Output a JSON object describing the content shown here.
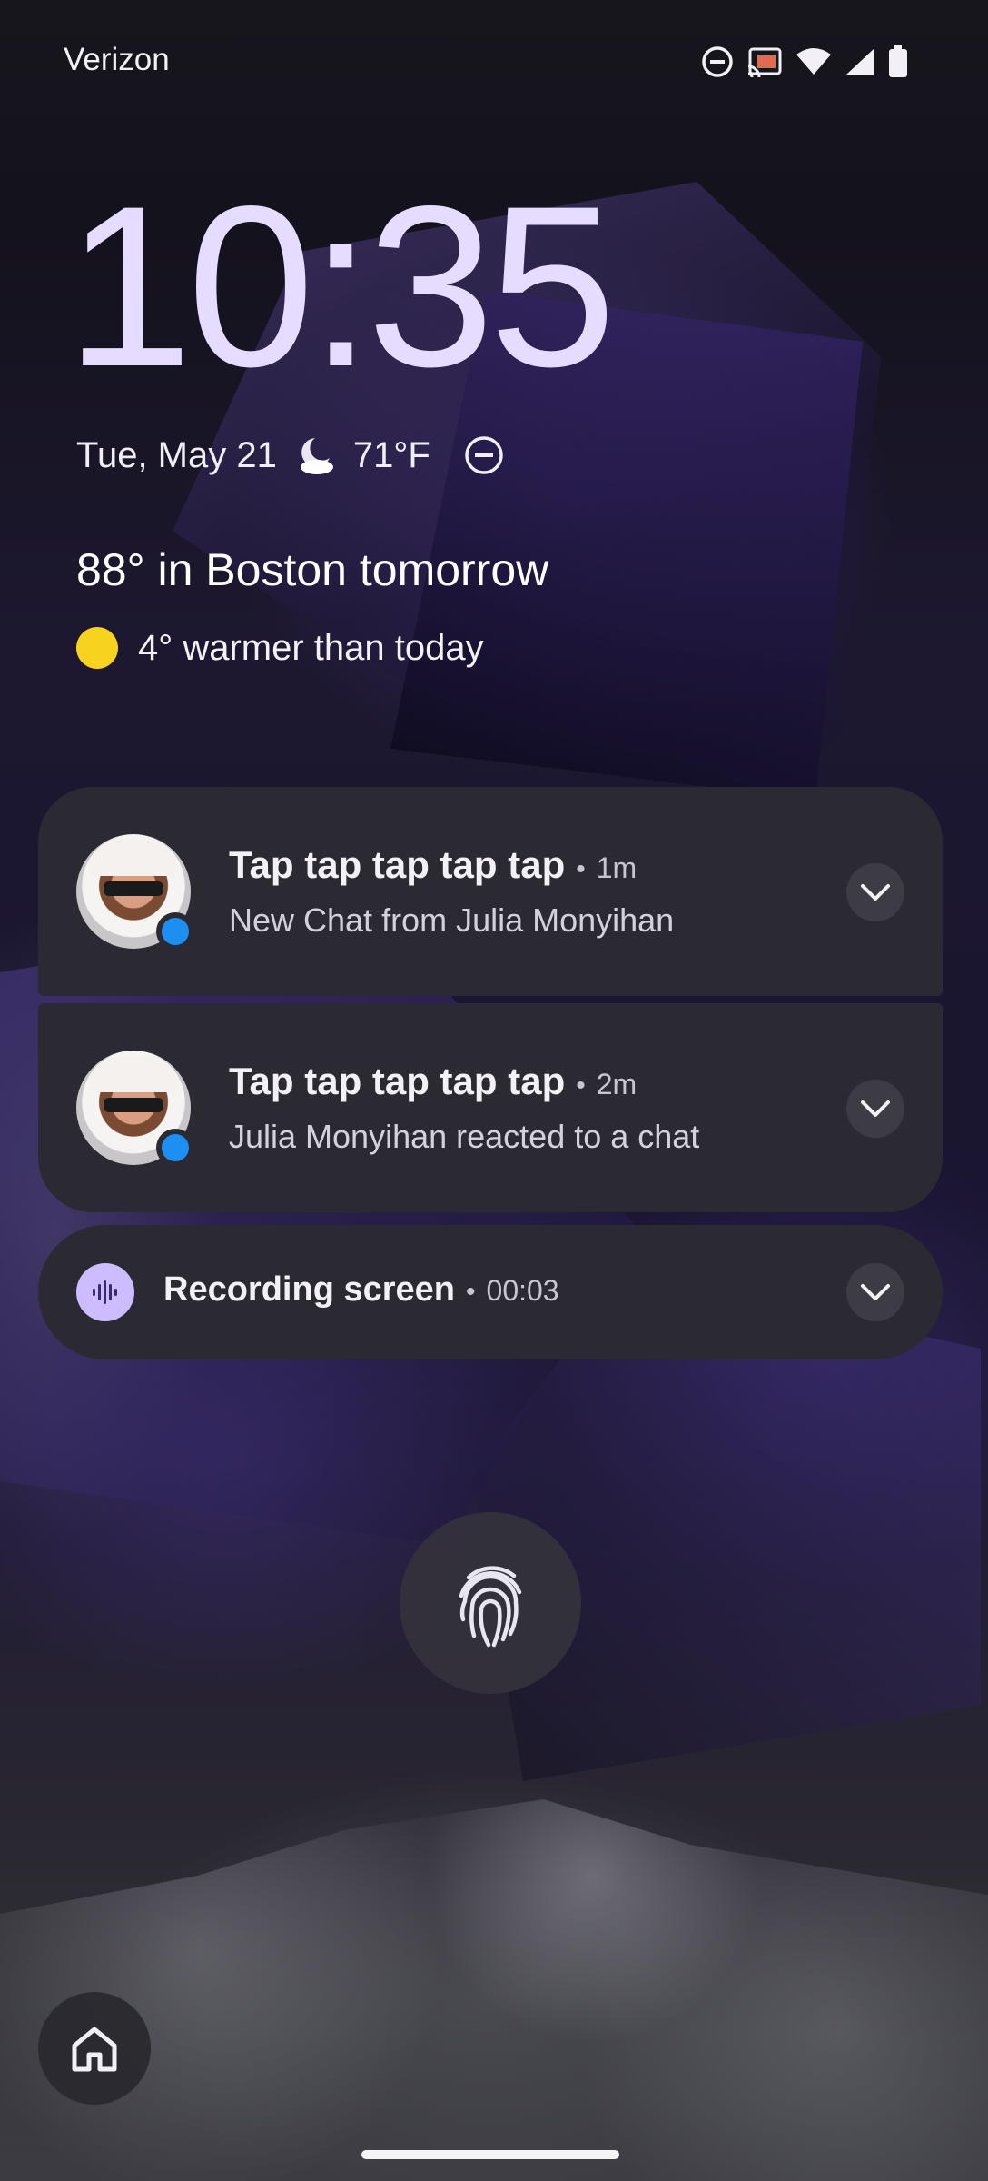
{
  "status_bar": {
    "carrier": "Verizon",
    "icons": [
      "dnd-icon",
      "cast-icon",
      "wifi-icon",
      "cell-signal-icon",
      "battery-icon"
    ]
  },
  "lockscreen": {
    "time": "10:35",
    "date": "Tue, May 21",
    "weather_icon": "moon-cloud-icon",
    "temperature": "71°F",
    "dnd_icon": "dnd-icon",
    "forecast_headline": "88° in Boston tomorrow",
    "forecast_icon": "sun-icon",
    "forecast_detail": "4° warmer than today"
  },
  "notifications": [
    {
      "app_icon": "snapchat-icon",
      "title": "Tap tap tap tap tap",
      "separator": "•",
      "time": "1m",
      "body": "New Chat from Julia Monyihan"
    },
    {
      "app_icon": "snapchat-icon",
      "title": "Tap tap tap tap tap",
      "separator": "•",
      "time": "2m",
      "body": "Julia Monyihan reacted to a chat"
    }
  ],
  "recording": {
    "icon": "audio-waveform-icon",
    "title": "Recording screen",
    "separator": "•",
    "time": "00:03"
  },
  "bottom": {
    "fingerprint_icon": "fingerprint-icon",
    "home_icon": "home-icon"
  },
  "colors": {
    "clock": "#e6dcff",
    "card_bg": "#2b2a33",
    "sun": "#f7d21e",
    "recording_accent": "#cdbcff",
    "snapchat_badge": "#1d8ff2"
  }
}
